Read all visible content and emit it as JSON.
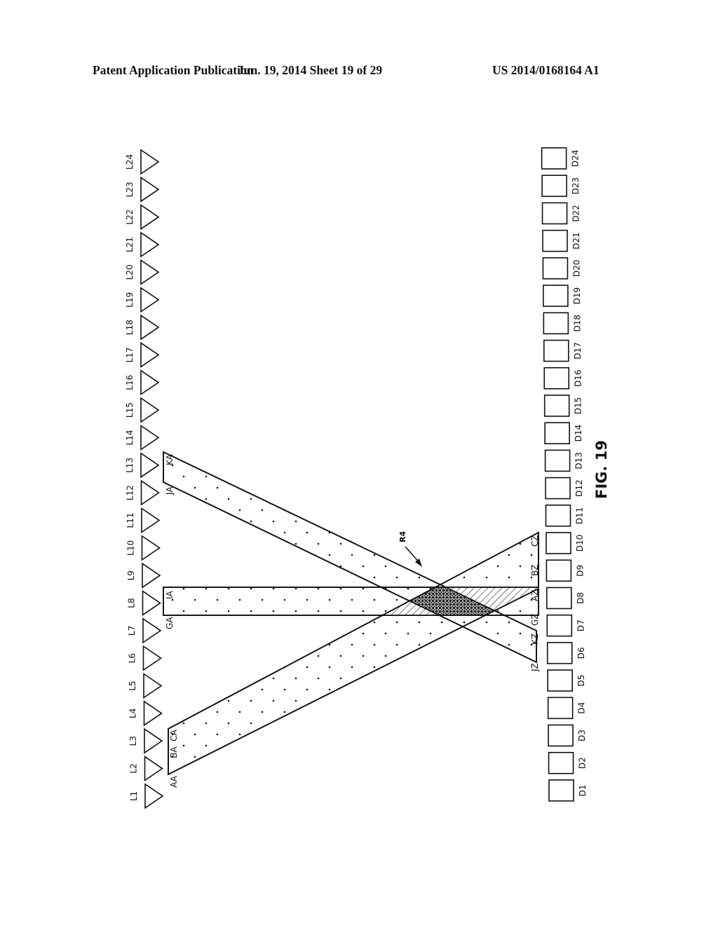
{
  "header": {
    "publication": "Patent Application Publication",
    "date_sheet": "Jun. 19, 2014  Sheet 19 of 29",
    "patent_number": "US 2014/0168164 A1"
  },
  "figure": {
    "label": "FIG. 19",
    "region_label": "R4",
    "emitters": [
      "L1",
      "L2",
      "L3",
      "L4",
      "L5",
      "L6",
      "L7",
      "L8",
      "L9",
      "L10",
      "L11",
      "L12",
      "L13",
      "L14",
      "L15",
      "L16",
      "L17",
      "L18",
      "L19",
      "L20",
      "L21",
      "L22",
      "L23",
      "L24"
    ],
    "detectors": [
      "D1",
      "D2",
      "D3",
      "D4",
      "D5",
      "D6",
      "D7",
      "D8",
      "D9",
      "D10",
      "D11",
      "D12",
      "D13",
      "D14",
      "D15",
      "D16",
      "D17",
      "D18",
      "D19",
      "D20",
      "D21",
      "D22",
      "D23",
      "D24"
    ],
    "beams": [
      {
        "name": "beam-j-k",
        "start_labels": [
          "JA",
          "KA"
        ],
        "end_labels": [
          "JZ",
          "KZ"
        ]
      },
      {
        "name": "beam-g-i",
        "start_labels": [
          "GA",
          "IA"
        ],
        "end_labels": [
          "GZ"
        ]
      },
      {
        "name": "beam-a-c",
        "start_labels": [
          "AA",
          "BA",
          "CA"
        ],
        "end_labels": [
          "AZ",
          "BZ",
          "CZ"
        ]
      }
    ],
    "point_labels": {
      "KA": "KA",
      "JA": "JA",
      "IA": "IA",
      "GA": "GA",
      "CA": "CA",
      "BA": "BA",
      "AA": "AA",
      "CZ": "CZ",
      "BZ": "BZ",
      "AZ": "AZ",
      "GZ": "GZ",
      "KZ": "KZ",
      "JZ": "JZ"
    }
  }
}
